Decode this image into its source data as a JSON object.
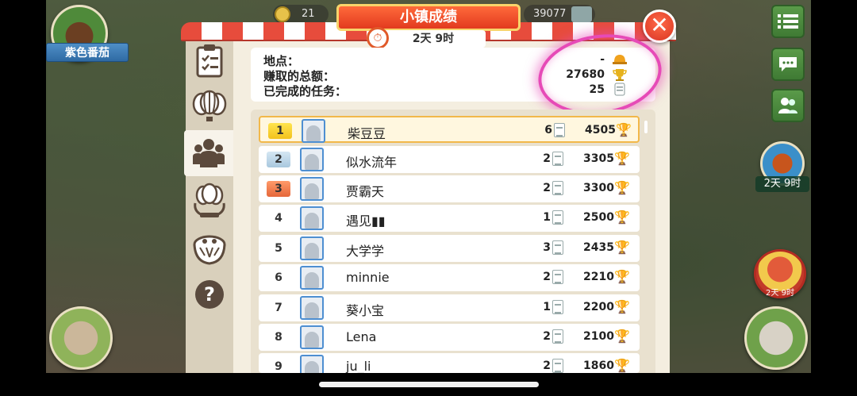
{
  "hud": {
    "avatar_label": "紫色番茄",
    "coins": "21",
    "cash": "39077",
    "event_timer": "2天 9时",
    "balloon_timer": "2天 9时"
  },
  "panel": {
    "title": "小镇成绩",
    "timer": "2天 9时",
    "close": "✕"
  },
  "stats": {
    "location_label": "地点：",
    "location_value": "-",
    "earned_label": "赚取的总额：",
    "earned_value": "27680",
    "tasks_label": "已完成的任务：",
    "tasks_value": "25"
  },
  "tabs": [
    {
      "name": "orders",
      "icon": "clipboard-icon"
    },
    {
      "name": "balloons",
      "icon": "balloon-icon"
    },
    {
      "name": "players",
      "icon": "people-icon",
      "active": true
    },
    {
      "name": "awards",
      "icon": "laurel-balloon-icon"
    },
    {
      "name": "rewards",
      "icon": "basket-icon"
    },
    {
      "name": "help",
      "icon": "help-icon",
      "label": "?"
    }
  ],
  "ranking": [
    {
      "rank": "1",
      "name": "柴豆豆",
      "tasks": "6",
      "score": "4505",
      "highlight": true
    },
    {
      "rank": "2",
      "name": "似水流年",
      "tasks": "2",
      "score": "3305"
    },
    {
      "rank": "3",
      "name": "贾霸天",
      "tasks": "2",
      "score": "3300"
    },
    {
      "rank": "4",
      "name": "遇见▮▮",
      "tasks": "1",
      "score": "2500"
    },
    {
      "rank": "5",
      "name": "大学学",
      "tasks": "3",
      "score": "2435"
    },
    {
      "rank": "6",
      "name": "minnie",
      "tasks": "2",
      "score": "2210"
    },
    {
      "rank": "7",
      "name": "葵小宝",
      "tasks": "1",
      "score": "2200"
    },
    {
      "rank": "8",
      "name": "Lena",
      "tasks": "2",
      "score": "2100"
    },
    {
      "rank": "9",
      "name": "ju_li",
      "tasks": "2",
      "score": "1860"
    }
  ],
  "colors": {
    "accent_red": "#e23a1f",
    "gold": "#f2c21d",
    "highlight_pink": "#e64ab7",
    "panel_bg": "#f4eee0"
  }
}
